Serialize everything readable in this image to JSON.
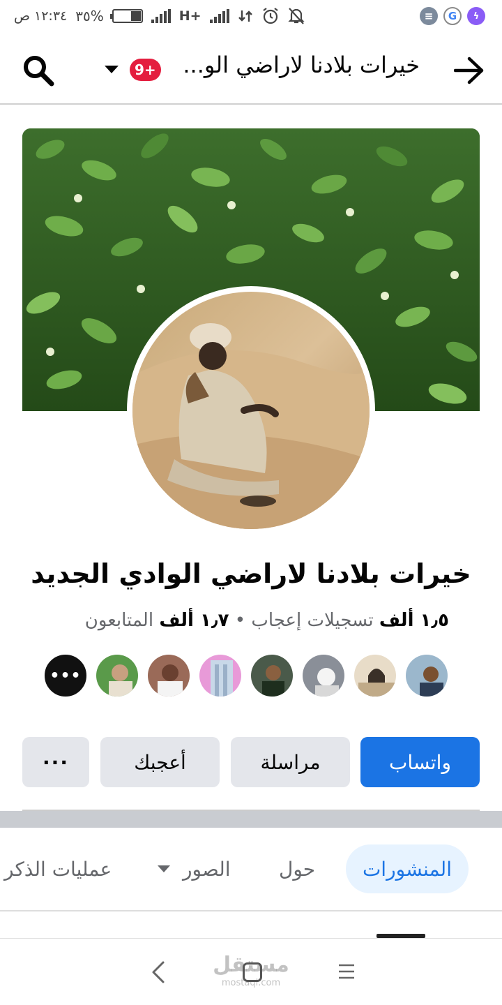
{
  "status_bar": {
    "time": "١٢:٣٤ ص",
    "battery": "٣٥%",
    "battery_level": 0.35,
    "network": "H+",
    "apps": [
      "notes-icon",
      "google-icon",
      "messenger-icon"
    ]
  },
  "header": {
    "title": "خيرات بلادنا لاراضي الو...",
    "badge": "9+",
    "back_icon": "arrow-right-icon",
    "search_icon": "search-icon"
  },
  "page": {
    "name": "خيرات بلادنا لاراضي الوادي الجديد",
    "likes_value": "١٫٥ ألف",
    "likes_label": "تسجيلات إعجاب",
    "separator": "•",
    "followers_value": "١٫٧ ألف",
    "followers_label": "المتابعون",
    "more_friends": "•••"
  },
  "actions": {
    "whatsapp": "واتساب",
    "message": "مراسلة",
    "like": "أعجبك",
    "more": "···"
  },
  "tabs": {
    "posts": "المنشورات",
    "about": "حول",
    "photos": "الصور",
    "mentions": "عمليات الذكر"
  },
  "watermark": {
    "text": "مستقل",
    "sub": "mostaql.com"
  },
  "colors": {
    "primary": "#1b74e4",
    "badge": "#e41e3f",
    "secondary_button": "#e4e6eb",
    "tab_active_bg": "#e7f3ff"
  }
}
